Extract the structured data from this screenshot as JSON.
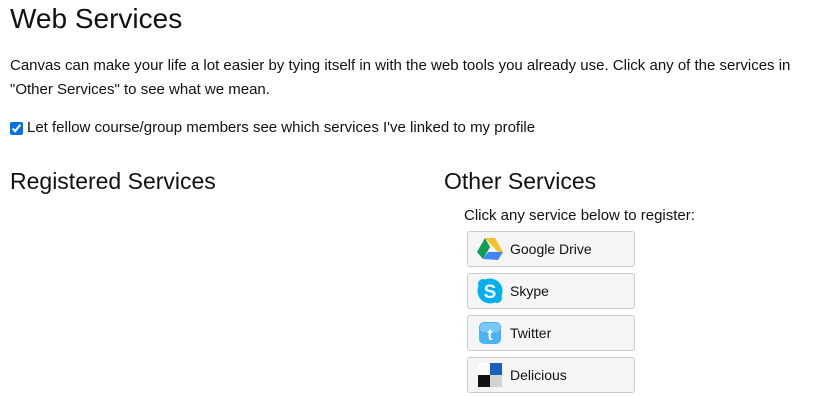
{
  "page": {
    "title": "Web Services",
    "intro": "Canvas can make your life a lot easier by tying itself in with the web tools you already use. Click any of the services in \"Other Services\" to see what we mean.",
    "share_label": "Let fellow course/group members see which services I've linked to my profile",
    "share_checked": true
  },
  "registered": {
    "heading": "Registered Services"
  },
  "other": {
    "heading": "Other Services",
    "hint": "Click any service below to register:",
    "services": [
      {
        "label": "Google Drive",
        "icon": "google-drive-icon"
      },
      {
        "label": "Skype",
        "icon": "skype-icon"
      },
      {
        "label": "Twitter",
        "icon": "twitter-icon"
      },
      {
        "label": "Delicious",
        "icon": "delicious-icon"
      }
    ]
  },
  "colors": {
    "text": "#111111",
    "button_bg": "#f5f5f5",
    "button_border": "#c7cdd1",
    "checkbox_accent": "#0770e3"
  }
}
